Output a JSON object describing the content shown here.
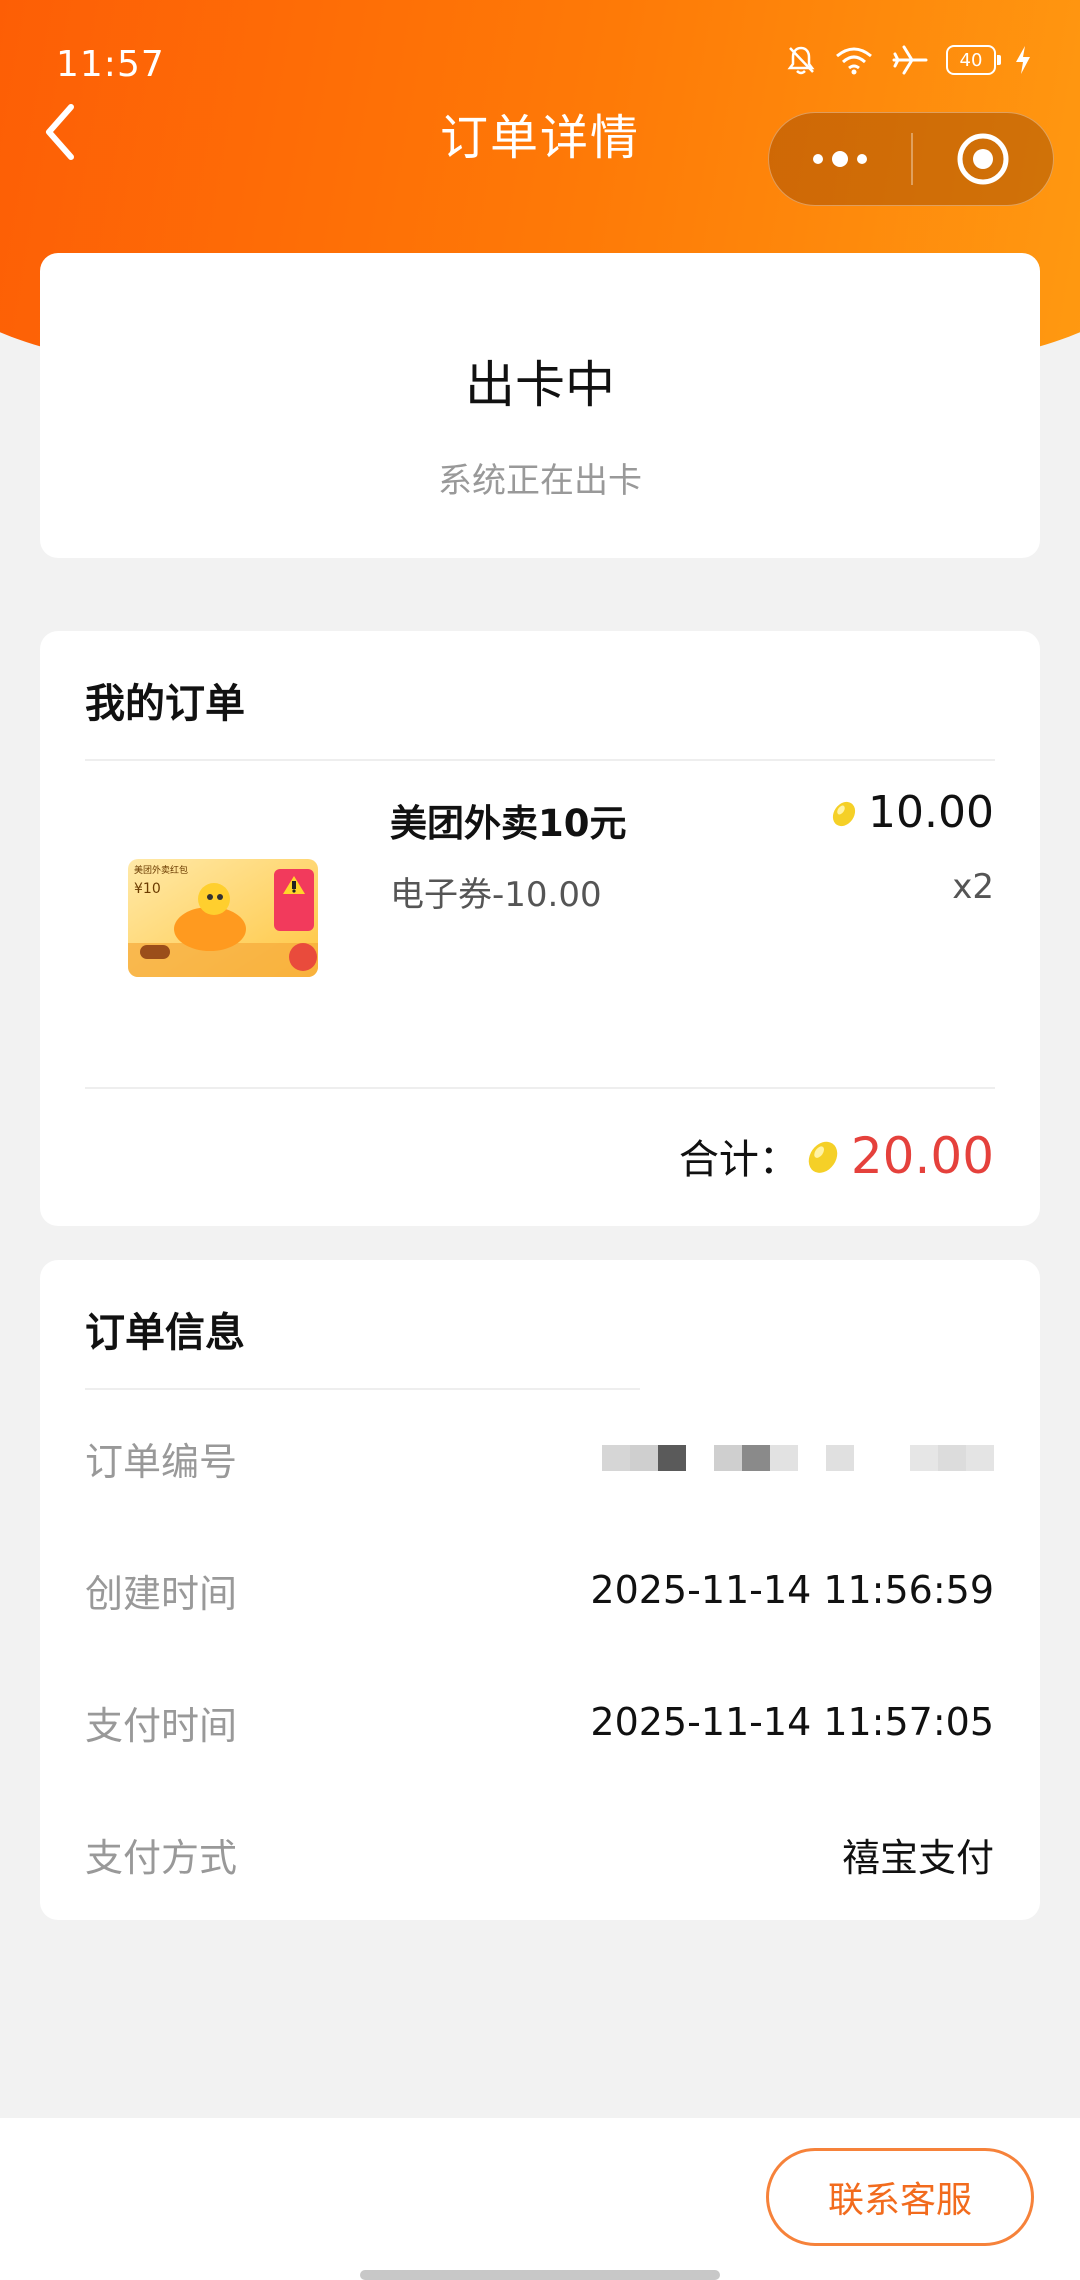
{
  "status_bar": {
    "time": "11:57",
    "battery": "40"
  },
  "nav": {
    "title": "订单详情"
  },
  "status_card": {
    "title": "出卡中",
    "description": "系统正在出卡"
  },
  "order": {
    "heading": "我的订单",
    "product_name": "美团外卖10元",
    "product_spec": "电子券-10.00",
    "price": "10.00",
    "quantity": "x2",
    "total_label": "合计：",
    "total_value": "20.00"
  },
  "info": {
    "heading": "订单信息",
    "rows": [
      {
        "label": "订单编号",
        "value": ""
      },
      {
        "label": "创建时间",
        "value": "2025-11-14 11:56:59"
      },
      {
        "label": "支付时间",
        "value": "2025-11-14 11:57:05"
      },
      {
        "label": "支付方式",
        "value": "禧宝支付"
      }
    ]
  },
  "footer": {
    "contact_label": "联系客服"
  },
  "colors": {
    "accent_orange": "#fe7a07",
    "total_red": "#e5413c",
    "button_border": "#f6823a"
  }
}
